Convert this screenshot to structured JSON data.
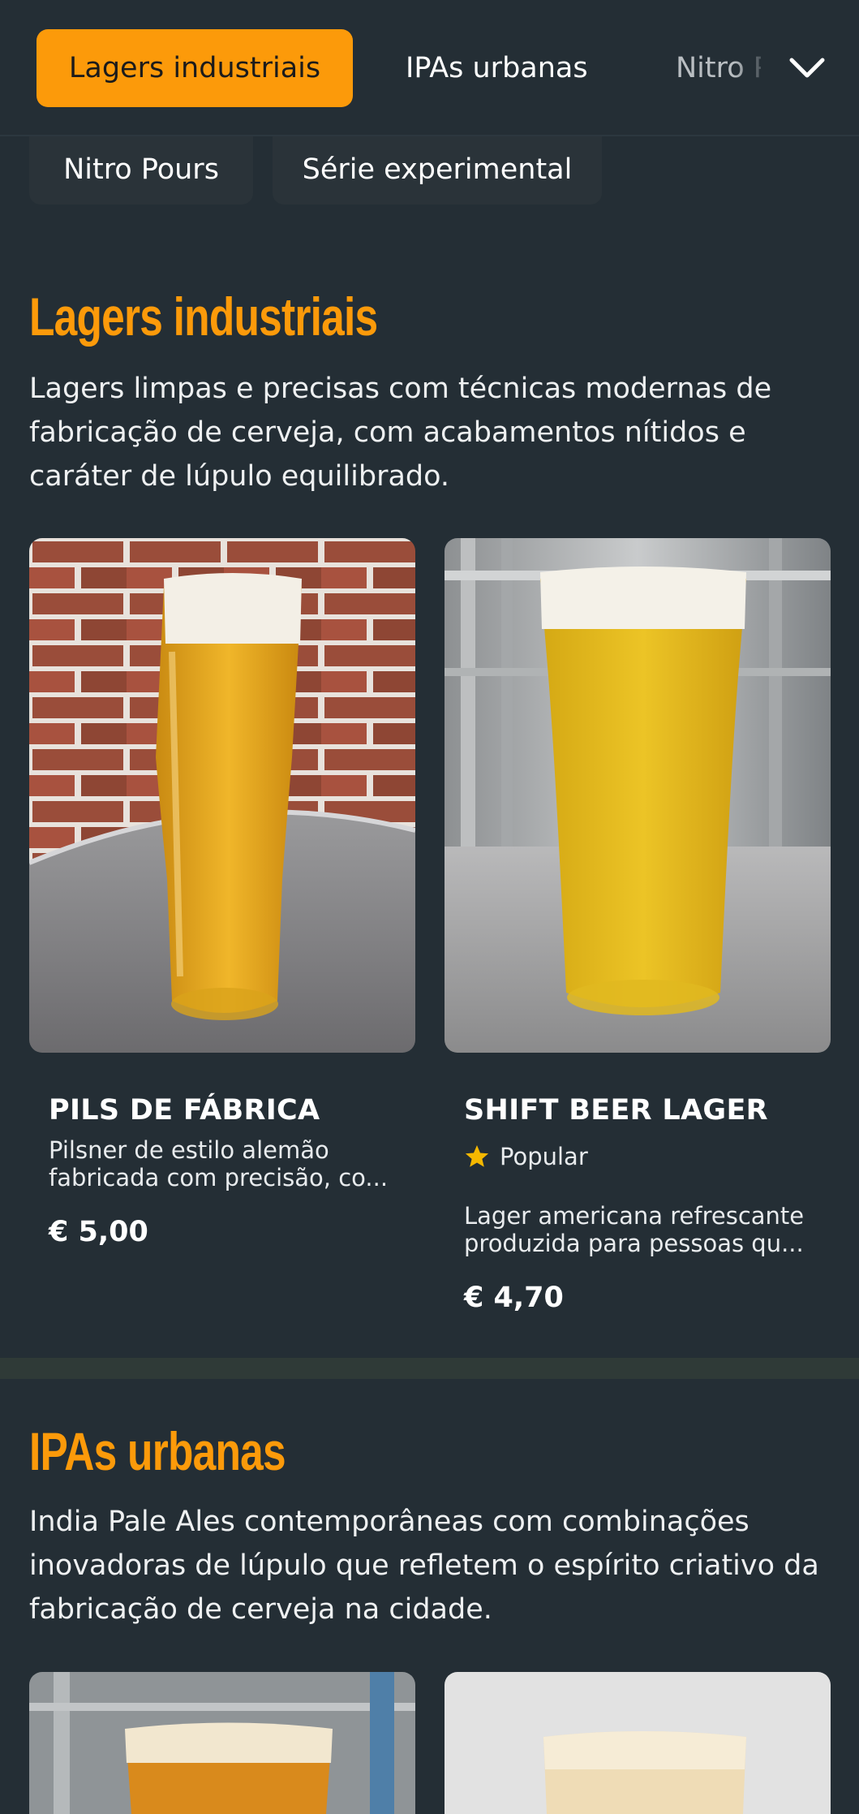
{
  "nav": {
    "tabs": [
      {
        "label": "Lagers industriais",
        "active": true
      },
      {
        "label": "IPAs urbanas",
        "active": false
      },
      {
        "label": "Nitro Pours",
        "active": false
      }
    ],
    "more_icon": "chevron-down-icon",
    "chips": [
      {
        "label": "Nitro Pours"
      },
      {
        "label": "Série experimental"
      }
    ]
  },
  "sections": [
    {
      "title": "Lagers industriais",
      "description": "Lagers limpas e precisas com técnicas modernas de fabricação de cerveja, com acabamentos nítidos e caráter de lúpulo equilibrado.",
      "items": [
        {
          "name": "PILS DE FÁBRICA",
          "description": "Pilsner de estilo alemão fabricada com precisão, co...",
          "price": "€ 5,00"
        },
        {
          "name": "SHIFT BEER LAGER",
          "badge": "Popular",
          "badge_icon": "star-icon",
          "description": "Lager americana refrescante produzida para pessoas qu...",
          "price": "€ 4,70"
        }
      ]
    },
    {
      "title": "IPAs urbanas",
      "description": "India Pale Ales contemporâneas com combinações inovadoras de lúpulo que refletem o espírito criativo da fabricação de cerveja na cidade."
    }
  ],
  "colors": {
    "accent": "#fc9a0a",
    "background": "#242e35",
    "star": "#f5b800"
  }
}
